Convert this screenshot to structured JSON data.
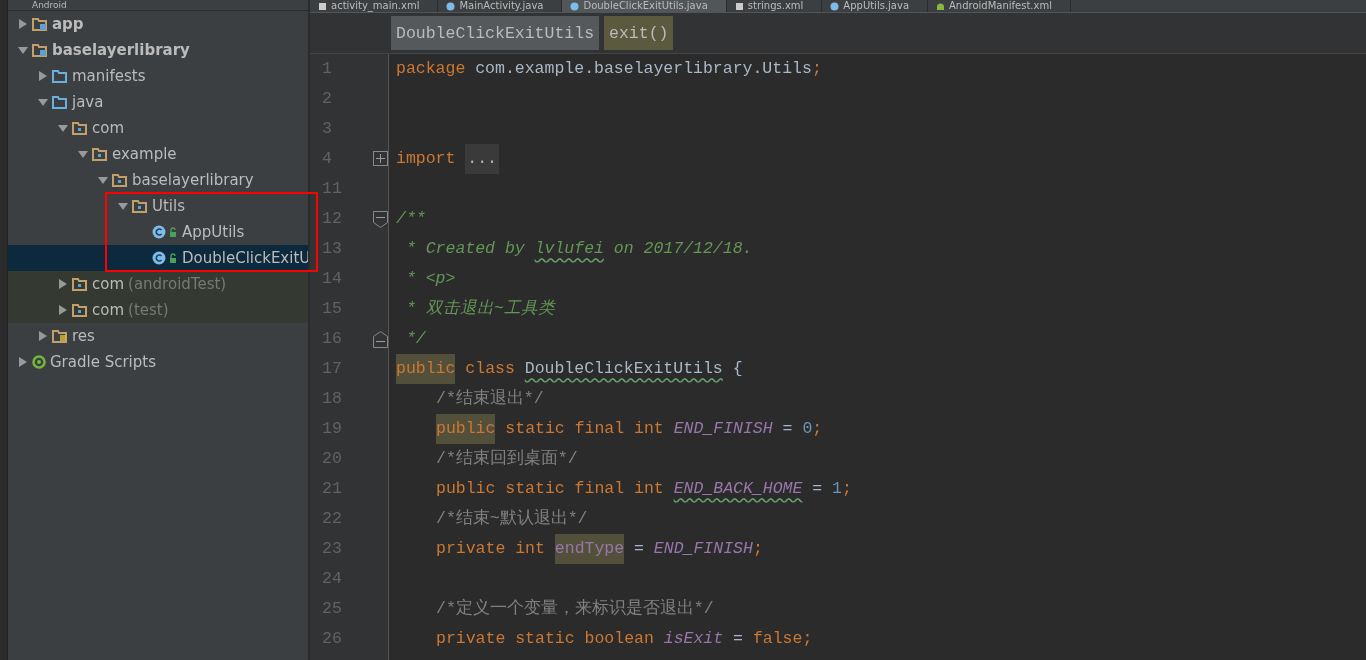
{
  "project_panel": {
    "title": "Android",
    "tree": [
      {
        "label": "app",
        "kind": "module",
        "expanded": false,
        "selected": false
      },
      {
        "label": "baselayerlibrary",
        "kind": "module",
        "expanded": true,
        "selected": false,
        "children": [
          {
            "label": "manifests",
            "kind": "folder",
            "expanded": false,
            "selected": false
          },
          {
            "label": "java",
            "kind": "folder",
            "expanded": true,
            "selected": false,
            "children": [
              {
                "label": "com",
                "kind": "package",
                "expanded": true,
                "selected": false,
                "children": [
                  {
                    "label": "example",
                    "kind": "package",
                    "expanded": true,
                    "selected": false,
                    "children": [
                      {
                        "label": "baselayerlibrary",
                        "kind": "package",
                        "expanded": true,
                        "selected": false,
                        "children": [
                          {
                            "label": "Utils",
                            "kind": "package",
                            "expanded": true,
                            "selected": false,
                            "children": [
                              {
                                "label": "AppUtils",
                                "kind": "class",
                                "selected": false
                              },
                              {
                                "label": "DoubleClickExitU",
                                "kind": "class",
                                "selected": true
                              }
                            ]
                          }
                        ]
                      }
                    ]
                  }
                ]
              },
              {
                "label": "com",
                "suffix": "(androidTest)",
                "kind": "package",
                "expanded": false,
                "selected": false,
                "test": true
              },
              {
                "label": "com",
                "suffix": "(test)",
                "kind": "package",
                "expanded": false,
                "selected": false,
                "test": true
              }
            ]
          },
          {
            "label": "res",
            "kind": "res",
            "expanded": false,
            "selected": false
          }
        ]
      },
      {
        "label": "Gradle Scripts",
        "kind": "gradle",
        "expanded": false,
        "selected": false
      }
    ]
  },
  "editor_tabs": [
    {
      "label": "activity_main.xml",
      "kind": "xml",
      "selected": false
    },
    {
      "label": "MainActivity.java",
      "kind": "class",
      "selected": false
    },
    {
      "label": "DoubleClickExitUtils.java",
      "kind": "class",
      "selected": true
    },
    {
      "label": "strings.xml",
      "kind": "xml",
      "selected": false
    },
    {
      "label": "AppUtils.java",
      "kind": "class",
      "selected": false
    },
    {
      "label": "AndroidManifest.xml",
      "kind": "manifest",
      "selected": false
    }
  ],
  "breadcrumbs": [
    {
      "label": "DoubleClickExitUtils",
      "selected": false
    },
    {
      "label": "exit()",
      "selected": true
    }
  ],
  "code": [
    {
      "number": "1",
      "kind": "code",
      "tokens": [
        {
          "kind": "keyword",
          "text": "package"
        },
        {
          "kind": "plain",
          "text": " com.example.baselayerlibrary.Utils"
        },
        {
          "kind": "keyword",
          "text": ";"
        }
      ]
    },
    {
      "number": "2",
      "kind": "code"
    },
    {
      "number": "3",
      "kind": "code"
    },
    {
      "number": "4",
      "kind": "fold_expand",
      "tokens": [
        {
          "kind": "keyword",
          "text": "import "
        },
        {
          "kind": "folded",
          "text": "..."
        }
      ]
    },
    {
      "number": "11",
      "kind": "code"
    },
    {
      "number": "12",
      "kind": "fold_start",
      "tokens": [
        {
          "kind": "doc",
          "text": "/**"
        }
      ]
    },
    {
      "number": "13",
      "kind": "code",
      "tokens": [
        {
          "kind": "doc",
          "text": " * Created by "
        },
        {
          "kind": "doc",
          "text": "lvlufei",
          "typo": true
        },
        {
          "kind": "doc",
          "text": " on 2017/12/18."
        }
      ]
    },
    {
      "number": "14",
      "kind": "code",
      "tokens": [
        {
          "kind": "doc",
          "text": " * <p>"
        }
      ]
    },
    {
      "number": "15",
      "kind": "code",
      "tokens": [
        {
          "kind": "doc",
          "text": " * 双击退出~工具类"
        }
      ]
    },
    {
      "number": "16",
      "kind": "fold_end",
      "tokens": [
        {
          "kind": "doc",
          "text": " */"
        }
      ]
    },
    {
      "number": "17",
      "kind": "code",
      "tokens": [
        {
          "kind": "keyword",
          "text": "public",
          "highlight": true
        },
        {
          "kind": "keyword",
          "text": " class "
        },
        {
          "kind": "plain",
          "text": "DoubleClickExitUtils",
          "typo": true
        },
        {
          "kind": "plain",
          "text": " {"
        }
      ]
    },
    {
      "number": "18",
      "kind": "code",
      "indented": true,
      "tokens": [
        {
          "kind": "comment",
          "text": "/*结束退出*/"
        }
      ]
    },
    {
      "number": "19",
      "kind": "code",
      "indented": true,
      "tokens": [
        {
          "kind": "keyword",
          "text": "public",
          "highlight": true
        },
        {
          "kind": "keyword",
          "text": " static final int "
        },
        {
          "kind": "static",
          "text": "END_FINISH"
        },
        {
          "kind": "plain",
          "text": " = "
        },
        {
          "kind": "number",
          "text": "0"
        },
        {
          "kind": "keyword",
          "text": ";"
        }
      ]
    },
    {
      "number": "20",
      "kind": "code",
      "indented": true,
      "tokens": [
        {
          "kind": "comment",
          "text": "/*结束回到桌面*/"
        }
      ]
    },
    {
      "number": "21",
      "kind": "code",
      "indented": true,
      "tokens": [
        {
          "kind": "keyword",
          "text": "public static final int "
        },
        {
          "kind": "static",
          "text": "END_BACK_HOME",
          "typo": true
        },
        {
          "kind": "plain",
          "text": " = "
        },
        {
          "kind": "number",
          "text": "1"
        },
        {
          "kind": "keyword",
          "text": ";"
        }
      ]
    },
    {
      "number": "22",
      "kind": "code",
      "indented": true,
      "tokens": [
        {
          "kind": "comment",
          "text": "/*结束~默认退出*/"
        }
      ]
    },
    {
      "number": "23",
      "kind": "code",
      "indented": true,
      "tokens": [
        {
          "kind": "keyword",
          "text": "private int "
        },
        {
          "kind": "field",
          "text": "endType",
          "highlight": true
        },
        {
          "kind": "plain",
          "text": " = "
        },
        {
          "kind": "static",
          "text": "END_FINISH"
        },
        {
          "kind": "keyword",
          "text": ";"
        }
      ]
    },
    {
      "number": "24",
      "kind": "code"
    },
    {
      "number": "25",
      "kind": "code",
      "indented": true,
      "tokens": [
        {
          "kind": "comment",
          "text": "/*定义一个变量，来标识是否退出*/"
        }
      ]
    },
    {
      "number": "26",
      "kind": "code",
      "indented": true,
      "tokens": [
        {
          "kind": "keyword",
          "text": "private static boolean "
        },
        {
          "kind": "static",
          "text": "isExit"
        },
        {
          "kind": "plain",
          "text": " = "
        },
        {
          "kind": "keyword",
          "text": "false;"
        }
      ]
    }
  ]
}
